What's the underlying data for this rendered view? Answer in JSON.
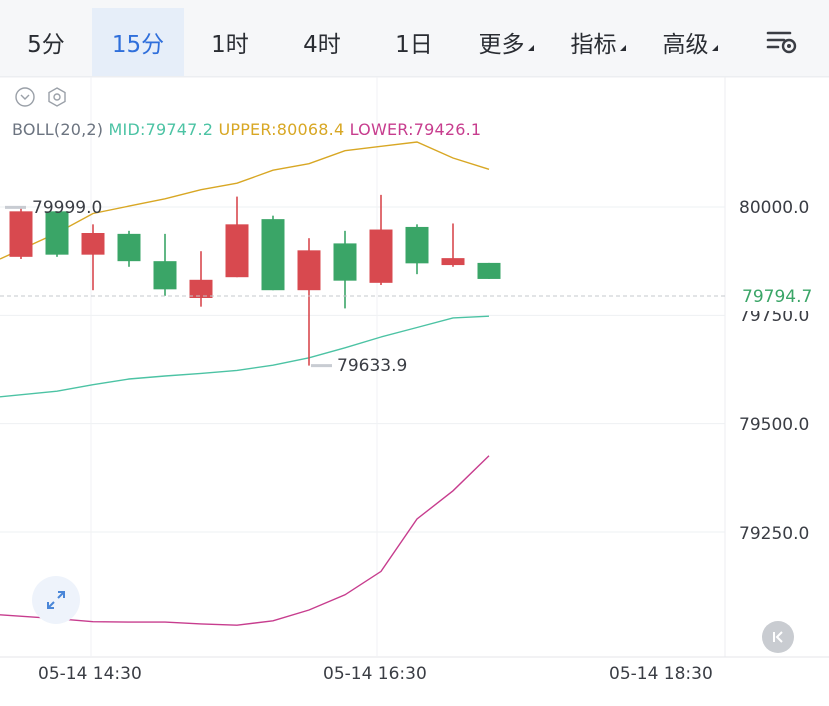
{
  "tabs": [
    {
      "label": "5分",
      "active": false,
      "dropdown": false
    },
    {
      "label": "15分",
      "active": true,
      "dropdown": false
    },
    {
      "label": "1时",
      "active": false,
      "dropdown": false
    },
    {
      "label": "4时",
      "active": false,
      "dropdown": false
    },
    {
      "label": "1日",
      "active": false,
      "dropdown": false
    },
    {
      "label": "更多",
      "active": false,
      "dropdown": true
    },
    {
      "label": "指标",
      "active": false,
      "dropdown": true
    },
    {
      "label": "高级",
      "active": false,
      "dropdown": true
    }
  ],
  "boll": {
    "name": "BOLL(20,2)",
    "mid": "MID:79747.2",
    "upper": "UPPER:80068.4",
    "lower": "LOWER:79426.1"
  },
  "price_axis": [
    "80000.0",
    "79750.0",
    "79500.0",
    "79250.0"
  ],
  "current_price": "79794.7",
  "high_marker": "79999.0",
  "low_marker": "79633.9",
  "time_axis": [
    "05-14 14:30",
    "05-14 16:30",
    "05-14 18:30"
  ],
  "colors": {
    "up": "#3aa567",
    "down": "#d8494f",
    "mid": "#4cc3a4",
    "upper": "#d8a724",
    "lower": "#c73d8e",
    "active_tab": "#2f6fdb"
  },
  "chart_data": {
    "type": "candlestick",
    "y_axis_ticks": [
      80000.0,
      79750.0,
      79500.0,
      79250.0
    ],
    "candles": [
      {
        "open": 79990,
        "close": 79885,
        "high": 79999,
        "low": 79880
      },
      {
        "open": 79890,
        "close": 79990,
        "high": 79990,
        "low": 79885
      },
      {
        "open": 79940,
        "close": 79890,
        "high": 79960,
        "low": 79808
      },
      {
        "open": 79875,
        "close": 79938,
        "high": 79945,
        "low": 79862
      },
      {
        "open": 79810,
        "close": 79875,
        "high": 79938,
        "low": 79795
      },
      {
        "open": 79832,
        "close": 79790,
        "high": 79898,
        "low": 79770
      },
      {
        "open": 79960,
        "close": 79838,
        "high": 80024,
        "low": 79838
      },
      {
        "open": 79808,
        "close": 79972,
        "high": 79980,
        "low": 79808
      },
      {
        "open": 79900,
        "close": 79808,
        "high": 79928,
        "low": 79634
      },
      {
        "open": 79830,
        "close": 79916,
        "high": 79945,
        "low": 79766
      },
      {
        "open": 79948,
        "close": 79825,
        "high": 80028,
        "low": 79820
      },
      {
        "open": 79870,
        "close": 79954,
        "high": 79960,
        "low": 79845
      },
      {
        "open": 79882,
        "close": 79866,
        "high": 79962,
        "low": 79862
      },
      {
        "open": 79834,
        "close": 79871,
        "high": 79871,
        "low": 79834
      }
    ],
    "bands": {
      "upper": [
        79880,
        79940,
        79985,
        80002,
        80019,
        80040,
        80055,
        80085,
        80100,
        80130,
        80140,
        80150,
        80113,
        80087
      ],
      "mid": [
        79562,
        79575,
        79590,
        79603,
        79610,
        79616,
        79623,
        79635,
        79652,
        79675,
        79700,
        79722,
        79744,
        79748
      ],
      "lower": [
        79059,
        79050,
        79043,
        79042,
        79042,
        79038,
        79035,
        79045,
        79070,
        79105,
        79159,
        79280,
        79345,
        79426
      ]
    }
  }
}
